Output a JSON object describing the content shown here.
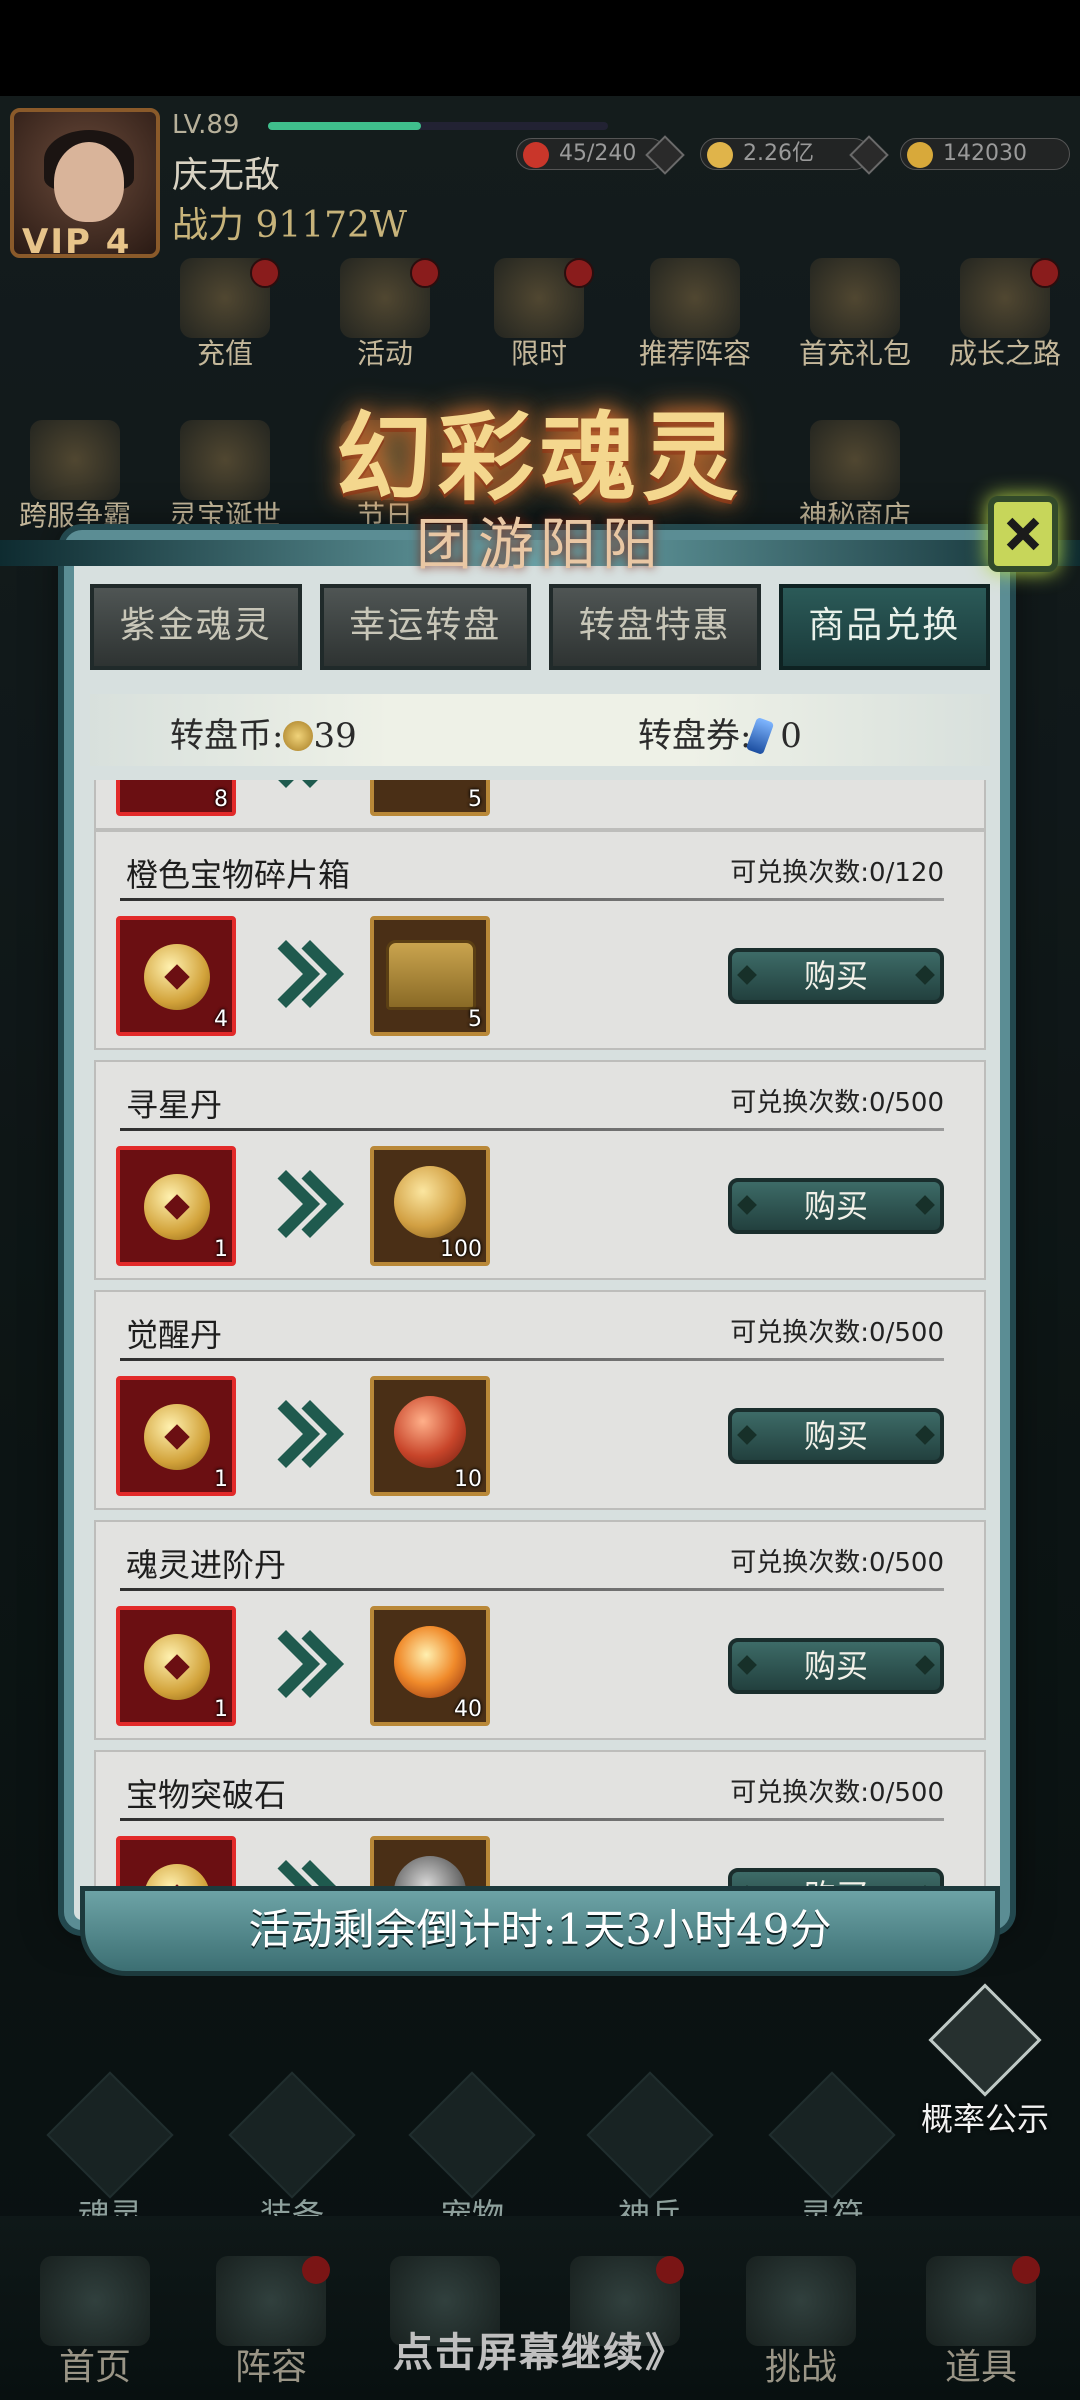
{
  "player": {
    "level": "LV.89",
    "level_progress": 0.45,
    "name": "庆无敌",
    "power": "战力 91172W",
    "vip": "VIP 4"
  },
  "resources": [
    {
      "icon": "stamina-icon",
      "value": "45/240",
      "color": "#c9362a"
    },
    {
      "icon": "gold-coin-icon",
      "value": "2.26亿",
      "color": "#e0b44a"
    },
    {
      "icon": "ingot-icon",
      "value": "142030",
      "color": "#d8a93a"
    }
  ],
  "top_icons_row1": [
    "充值",
    "活动",
    "限时",
    "推荐阵容",
    "首充礼包",
    "成长之路"
  ],
  "top_icons_row2": [
    "跨服争霸",
    "灵宝诞世",
    "节日",
    "",
    "",
    "神秘商店"
  ],
  "dialog": {
    "title": "幻彩魂灵",
    "subtitle": "团游阳阳",
    "tabs": [
      "紫金魂灵",
      "幸运转盘",
      "转盘特惠",
      "商品兑换"
    ],
    "active_tab": 3,
    "currency": {
      "coin_label": "转盘币:",
      "coin_value": "39",
      "ticket_label": "转盘券:",
      "ticket_value": "0"
    },
    "partial_top_row": {
      "cost_qty": "8",
      "reward_qty": "5"
    },
    "items": [
      {
        "name": "橙色宝物碎片箱",
        "limit": "可兑换次数:0/120",
        "cost_qty": "4",
        "reward_qty": "5",
        "reward_icon": "treasure-chest-icon",
        "buy_label": "购买"
      },
      {
        "name": "寻星丹",
        "limit": "可兑换次数:0/500",
        "cost_qty": "1",
        "reward_qty": "100",
        "reward_icon": "gold-pill-icon",
        "buy_label": "购买"
      },
      {
        "name": "觉醒丹",
        "limit": "可兑换次数:0/500",
        "cost_qty": "1",
        "reward_qty": "10",
        "reward_icon": "red-pill-icon",
        "buy_label": "购买"
      },
      {
        "name": "魂灵进阶丹",
        "limit": "可兑换次数:0/500",
        "cost_qty": "1",
        "reward_qty": "40",
        "reward_icon": "fire-orb-icon",
        "buy_label": "购买"
      },
      {
        "name": "宝物突破石",
        "limit": "可兑换次数:0/500",
        "cost_qty": "",
        "reward_qty": "",
        "reward_icon": "stone-icon",
        "buy_label": "购买"
      }
    ],
    "countdown": "活动剩余倒计时:1天3小时49分"
  },
  "probability_notice": "概率公示",
  "mid_nav": [
    "魂灵",
    "装备",
    "宠物",
    "神兵",
    "灵符"
  ],
  "bottom_nav": [
    "首页",
    "阵容",
    "",
    "",
    "挑战",
    "道具"
  ],
  "continue_hint": "点击屏幕继续》"
}
